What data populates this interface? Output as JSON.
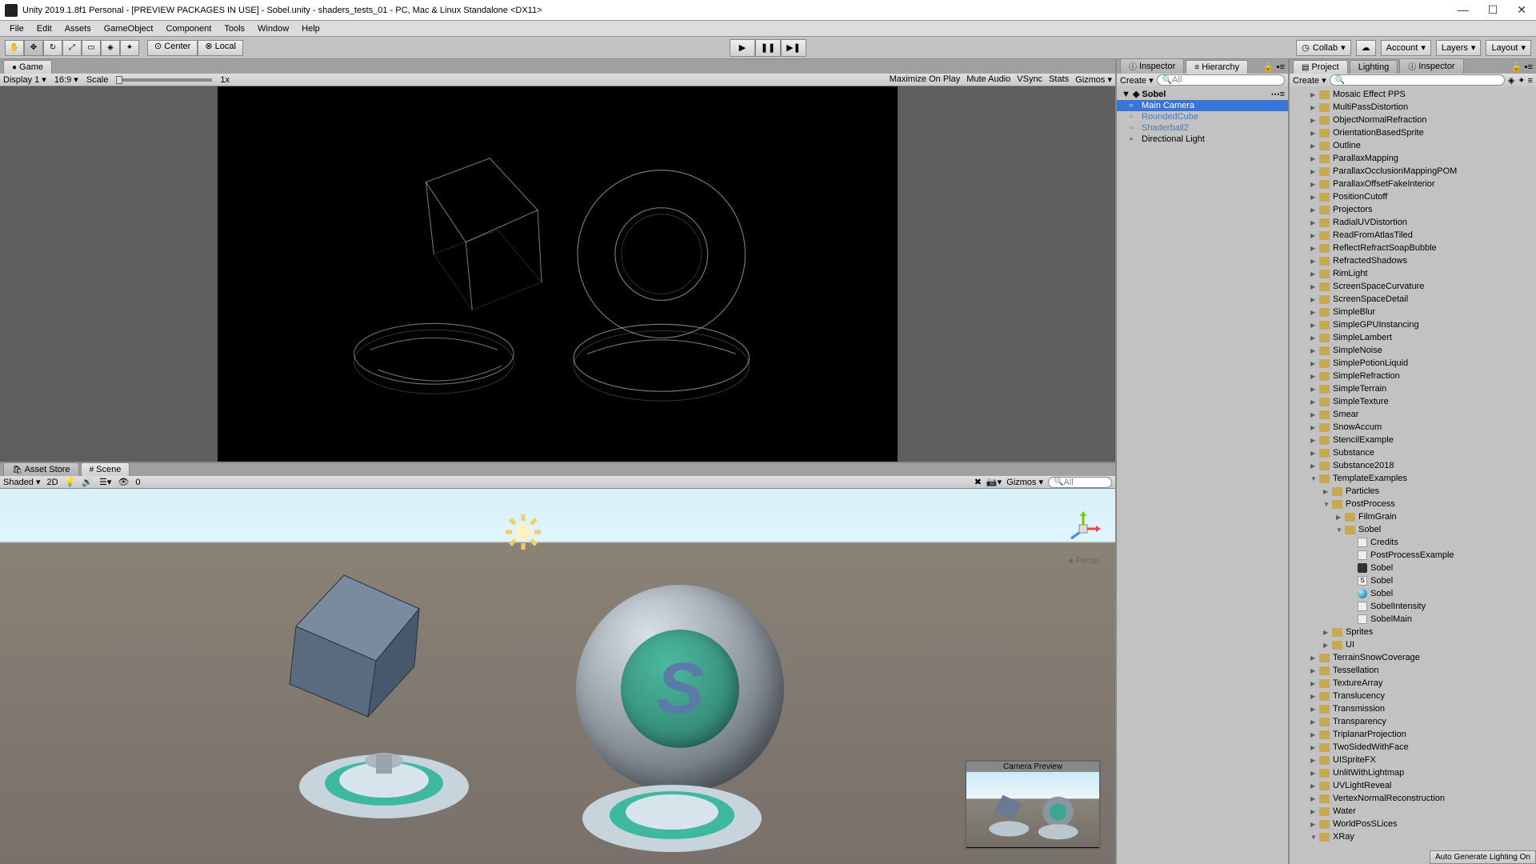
{
  "title": "Unity 2019.1.8f1 Personal - [PREVIEW PACKAGES IN USE] - Sobel.unity - shaders_tests_01 - PC, Mac & Linux Standalone <DX11>",
  "menu": [
    "File",
    "Edit",
    "Assets",
    "GameObject",
    "Component",
    "Tools",
    "Window",
    "Help"
  ],
  "pivot": {
    "center": "Center",
    "local": "Local"
  },
  "topRight": {
    "collab": "Collab",
    "account": "Account",
    "layers": "Layers",
    "layout": "Layout"
  },
  "gameTab": "Game",
  "gameBar": {
    "display": "Display 1",
    "aspect": "16:9",
    "scale": "Scale",
    "scaleVal": "1x",
    "maxOnPlay": "Maximize On Play",
    "muteAudio": "Mute Audio",
    "vsync": "VSync",
    "stats": "Stats",
    "gizmos": "Gizmos"
  },
  "assetStoreTab": "Asset Store",
  "sceneTab": "Scene",
  "sceneBar": {
    "shaded": "Shaded",
    "twoD": "2D",
    "count": "0",
    "gizmos": "Gizmos",
    "persp": "Persp",
    "searchPlaceholder": "All"
  },
  "camPreview": "Camera Preview",
  "inspectorTab": "Inspector",
  "hierarchyTab": "Hierarchy",
  "projectTab": "Project",
  "lightingTab": "Lighting",
  "create": "Create",
  "searchAll": "All",
  "hierarchy": {
    "root": "Sobel",
    "items": [
      {
        "name": "Main Camera",
        "selected": true
      },
      {
        "name": "RoundedCube",
        "prefab": true
      },
      {
        "name": "Shaderball2",
        "prefab": true
      },
      {
        "name": "Directional Light"
      }
    ]
  },
  "project": [
    {
      "n": "Mosaic Effect PPS",
      "d": 0
    },
    {
      "n": "MultiPassDistortion",
      "d": 0
    },
    {
      "n": "ObjectNormalRefraction",
      "d": 0
    },
    {
      "n": "OrientationBasedSprite",
      "d": 0
    },
    {
      "n": "Outline",
      "d": 0
    },
    {
      "n": "ParallaxMapping",
      "d": 0
    },
    {
      "n": "ParallaxOcclusionMappingPOM",
      "d": 0
    },
    {
      "n": "ParallaxOffsetFakeInterior",
      "d": 0
    },
    {
      "n": "PositionCutoff",
      "d": 0
    },
    {
      "n": "Projectors",
      "d": 0
    },
    {
      "n": "RadialUVDistortion",
      "d": 0
    },
    {
      "n": "ReadFromAtlasTiled",
      "d": 0
    },
    {
      "n": "ReflectRefractSoapBubble",
      "d": 0
    },
    {
      "n": "RefractedShadows",
      "d": 0
    },
    {
      "n": "RimLight",
      "d": 0
    },
    {
      "n": "ScreenSpaceCurvature",
      "d": 0
    },
    {
      "n": "ScreenSpaceDetail",
      "d": 0
    },
    {
      "n": "SimpleBlur",
      "d": 0
    },
    {
      "n": "SimpleGPUInstancing",
      "d": 0
    },
    {
      "n": "SimpleLambert",
      "d": 0
    },
    {
      "n": "SimpleNoise",
      "d": 0
    },
    {
      "n": "SimplePotionLiquid",
      "d": 0
    },
    {
      "n": "SimpleRefraction",
      "d": 0
    },
    {
      "n": "SimpleTerrain",
      "d": 0
    },
    {
      "n": "SimpleTexture",
      "d": 0
    },
    {
      "n": "Smear",
      "d": 0
    },
    {
      "n": "SnowAccum",
      "d": 0
    },
    {
      "n": "StencilExample",
      "d": 0
    },
    {
      "n": "Substance",
      "d": 0
    },
    {
      "n": "Substance2018",
      "d": 0
    },
    {
      "n": "TemplateExamples",
      "d": 0,
      "open": true
    },
    {
      "n": "Particles",
      "d": 1
    },
    {
      "n": "PostProcess",
      "d": 1,
      "open": true
    },
    {
      "n": "FilmGrain",
      "d": 2
    },
    {
      "n": "Sobel",
      "d": 2,
      "open": true
    },
    {
      "n": "Credits",
      "d": 3,
      "file": true
    },
    {
      "n": "PostProcessExample",
      "d": 3,
      "file": true
    },
    {
      "n": "Sobel",
      "d": 3,
      "unity": true
    },
    {
      "n": "Sobel",
      "d": 3,
      "file": true,
      "badge": "S"
    },
    {
      "n": "Sobel",
      "d": 3,
      "mat": true
    },
    {
      "n": "SobelIntensity",
      "d": 3,
      "file": true
    },
    {
      "n": "SobelMain",
      "d": 3,
      "file": true
    },
    {
      "n": "Sprites",
      "d": 1
    },
    {
      "n": "UI",
      "d": 1
    },
    {
      "n": "TerrainSnowCoverage",
      "d": 0
    },
    {
      "n": "Tessellation",
      "d": 0
    },
    {
      "n": "TextureArray",
      "d": 0
    },
    {
      "n": "Translucency",
      "d": 0
    },
    {
      "n": "Transmission",
      "d": 0
    },
    {
      "n": "Transparency",
      "d": 0
    },
    {
      "n": "TriplanarProjection",
      "d": 0
    },
    {
      "n": "TwoSidedWithFace",
      "d": 0
    },
    {
      "n": "UISpriteFX",
      "d": 0
    },
    {
      "n": "UnlitWithLightmap",
      "d": 0
    },
    {
      "n": "UVLightReveal",
      "d": 0
    },
    {
      "n": "VertexNormalReconstruction",
      "d": 0
    },
    {
      "n": "Water",
      "d": 0
    },
    {
      "n": "WorldPosSLices",
      "d": 0
    },
    {
      "n": "XRay",
      "d": 0,
      "open": true
    }
  ],
  "footer": "Auto Generate Lighting On"
}
